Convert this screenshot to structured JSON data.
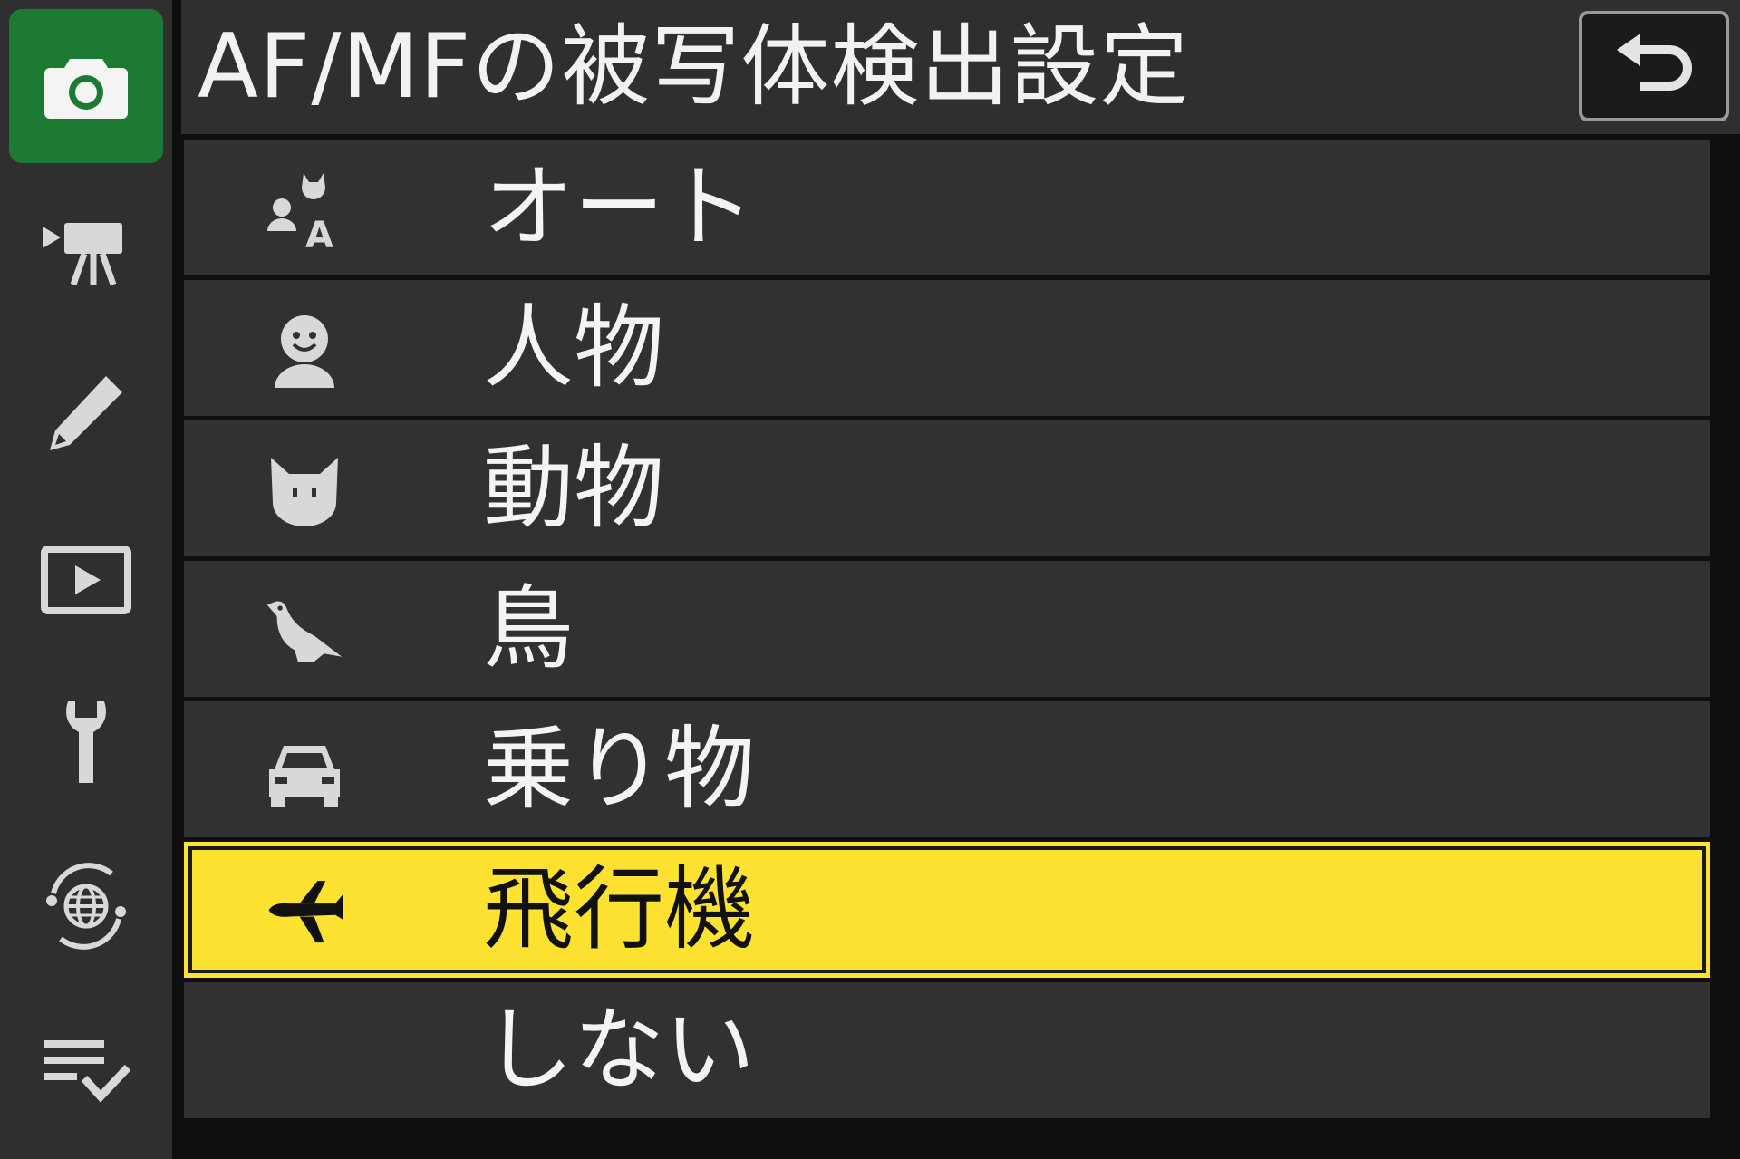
{
  "header": {
    "title": "AF/MFの被写体検出設定",
    "back_icon": "return-icon"
  },
  "sidebar": {
    "tabs": [
      {
        "icon": "camera-icon",
        "active": true
      },
      {
        "icon": "movie-camera-icon",
        "active": false
      },
      {
        "icon": "pencil-icon",
        "active": false
      },
      {
        "icon": "playback-icon",
        "active": false
      },
      {
        "icon": "wrench-icon",
        "active": false
      },
      {
        "icon": "network-globe-icon",
        "active": false
      },
      {
        "icon": "my-menu-checklist-icon",
        "active": false
      }
    ],
    "accent_color": "#1d7a33"
  },
  "menu": {
    "items": [
      {
        "label": "オート",
        "icon": "auto-detect-icon",
        "selected": false
      },
      {
        "label": "人物",
        "icon": "person-icon",
        "selected": false
      },
      {
        "label": "動物",
        "icon": "animal-icon",
        "selected": false
      },
      {
        "label": "鳥",
        "icon": "bird-icon",
        "selected": false
      },
      {
        "label": "乗り物",
        "icon": "vehicle-icon",
        "selected": false
      },
      {
        "label": "飛行機",
        "icon": "airplane-icon",
        "selected": true
      },
      {
        "label": "しない",
        "icon": "",
        "selected": false
      }
    ],
    "highlight_color": "#fde232"
  }
}
